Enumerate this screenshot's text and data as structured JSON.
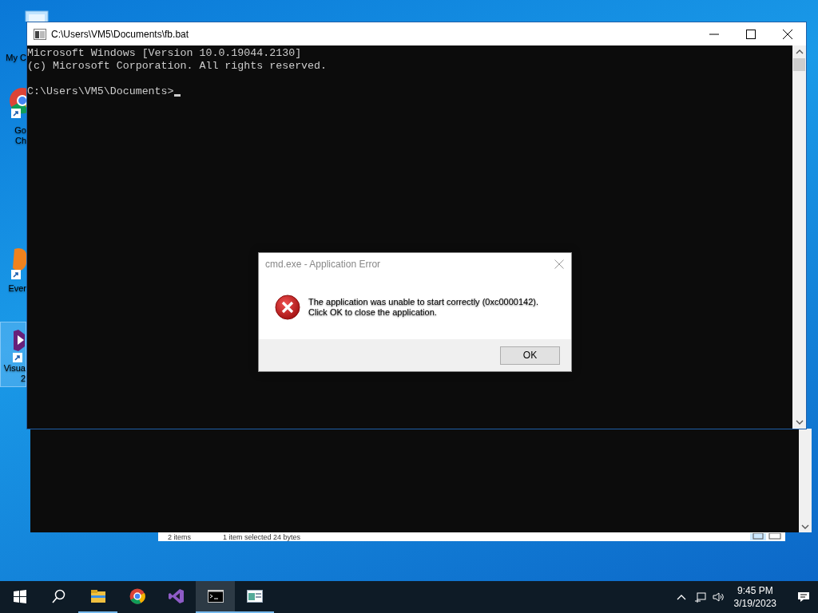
{
  "desktop_icons": [
    {
      "kind": "computer",
      "lines": [
        "My C"
      ],
      "selected": false
    },
    {
      "kind": "chrome",
      "lines": [
        "Go",
        "Ch"
      ],
      "selected": false
    },
    {
      "kind": "evernote",
      "lines": [
        "Ever"
      ],
      "selected": false
    },
    {
      "kind": "visualstudio",
      "lines": [
        "Visua",
        "2"
      ],
      "selected": true
    }
  ],
  "console_window": {
    "title": "C:\\Users\\VM5\\Documents\\fb.bat",
    "lines": [
      "Microsoft Windows [Version 10.0.19044.2130]",
      "(c) Microsoft Corporation. All rights reserved."
    ],
    "prompt": "C:\\Users\\VM5\\Documents>"
  },
  "explorer_status_bar": {
    "items": "2 items",
    "selection": "1 item selected  24 bytes"
  },
  "dialog": {
    "title": "cmd.exe - Application Error",
    "message": [
      "The application was unable to start correctly (0xc0000142).",
      "Click OK to close the application."
    ],
    "button": "OK"
  },
  "taskbar": {
    "items": [
      {
        "kind": "start",
        "running": false,
        "active": false
      },
      {
        "kind": "search",
        "running": false,
        "active": false
      },
      {
        "kind": "explorer",
        "running": true,
        "active": false
      },
      {
        "kind": "chrome",
        "running": false,
        "active": false
      },
      {
        "kind": "visualstudio",
        "running": false,
        "active": false
      },
      {
        "kind": "cmd",
        "running": true,
        "active": true
      },
      {
        "kind": "app",
        "running": true,
        "active": false
      }
    ],
    "tray": [
      {
        "kind": "chevron"
      },
      {
        "kind": "network"
      },
      {
        "kind": "volume"
      }
    ],
    "time": "9:45 PM",
    "date": "3/19/2023"
  }
}
